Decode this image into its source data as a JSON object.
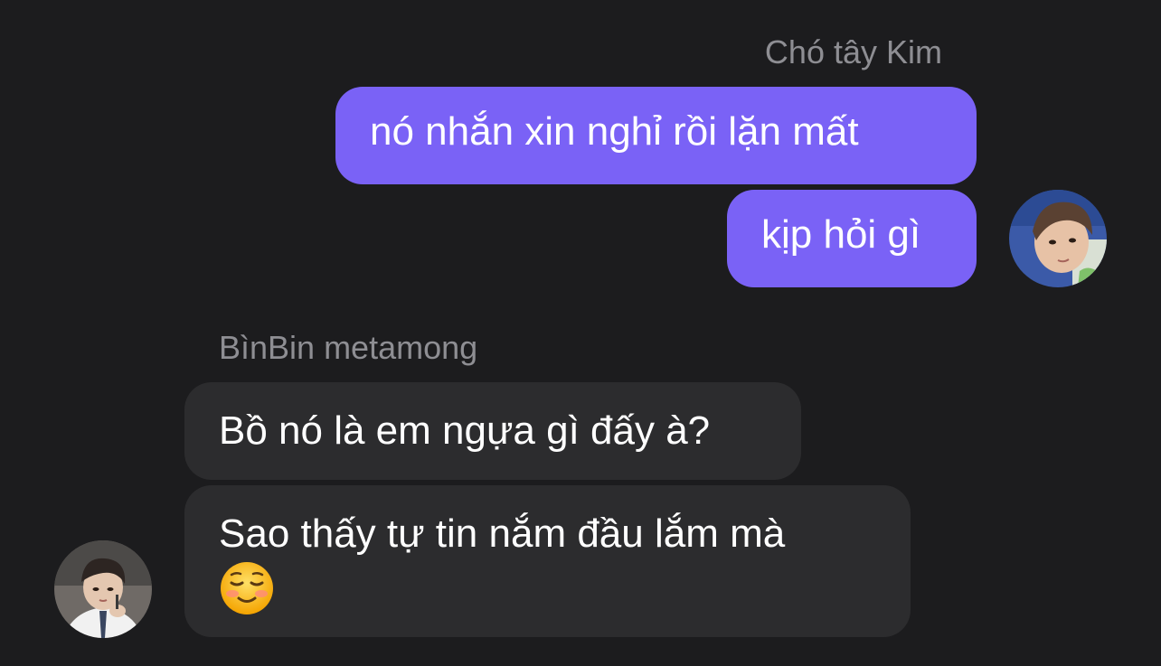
{
  "conversation": {
    "outgoing_group": {
      "sender_name": "Chó tây Kim",
      "messages": [
        {
          "text": "nó nhắn xin nghỉ rồi lặn mất"
        },
        {
          "text": "kịp hỏi gì"
        }
      ],
      "avatar_icon": "avatar-photo-icon"
    },
    "incoming_group": {
      "sender_name": "BìnBin metamong",
      "messages": [
        {
          "text": "Bồ nó là em ngựa gì đấy à?"
        },
        {
          "text": "Sao thấy tự tin nắm đầu lắm mà",
          "emoji_icon": "smiling-blush-emoji-icon"
        }
      ],
      "avatar_icon": "avatar-photo-icon"
    }
  },
  "colors": {
    "background": "#1c1c1e",
    "outgoing_bubble": "#7a62f6",
    "incoming_bubble": "#2c2c2e",
    "sender_name": "#8e8e93",
    "message_text": "#ffffff"
  }
}
